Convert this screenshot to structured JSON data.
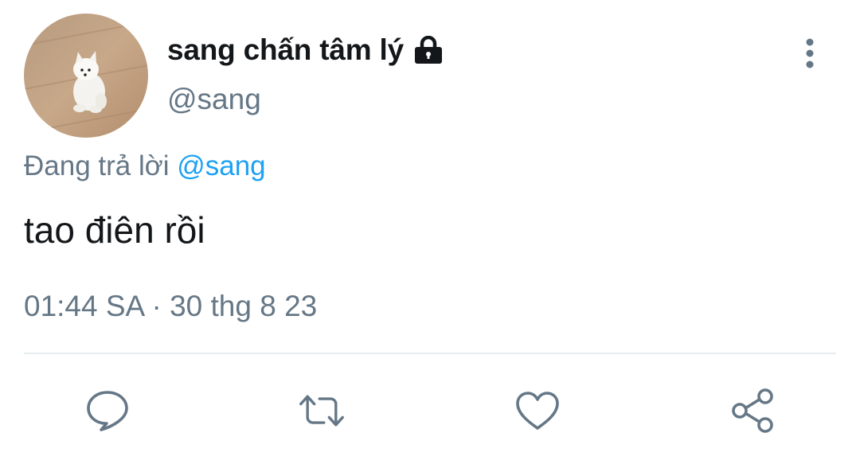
{
  "author": {
    "display_name": "sang chấn tâm lý",
    "handle": "@sang",
    "protected": true
  },
  "reply_context": {
    "prefix": "Đang trả lời",
    "mention": "@sang"
  },
  "tweet": {
    "text": "tao điên rồi",
    "time": "01:44 SA",
    "separator": "·",
    "date": "30 thg 8 23"
  },
  "icons": {
    "lock": "lock-icon",
    "more": "more-vertical-icon",
    "reply": "reply-icon",
    "retweet": "retweet-icon",
    "like": "heart-icon",
    "share": "share-icon"
  },
  "colors": {
    "text_primary": "#14171a",
    "text_secondary": "#657786",
    "link": "#1da1f2",
    "divider": "#e6ecf0",
    "icon": "#657786"
  }
}
